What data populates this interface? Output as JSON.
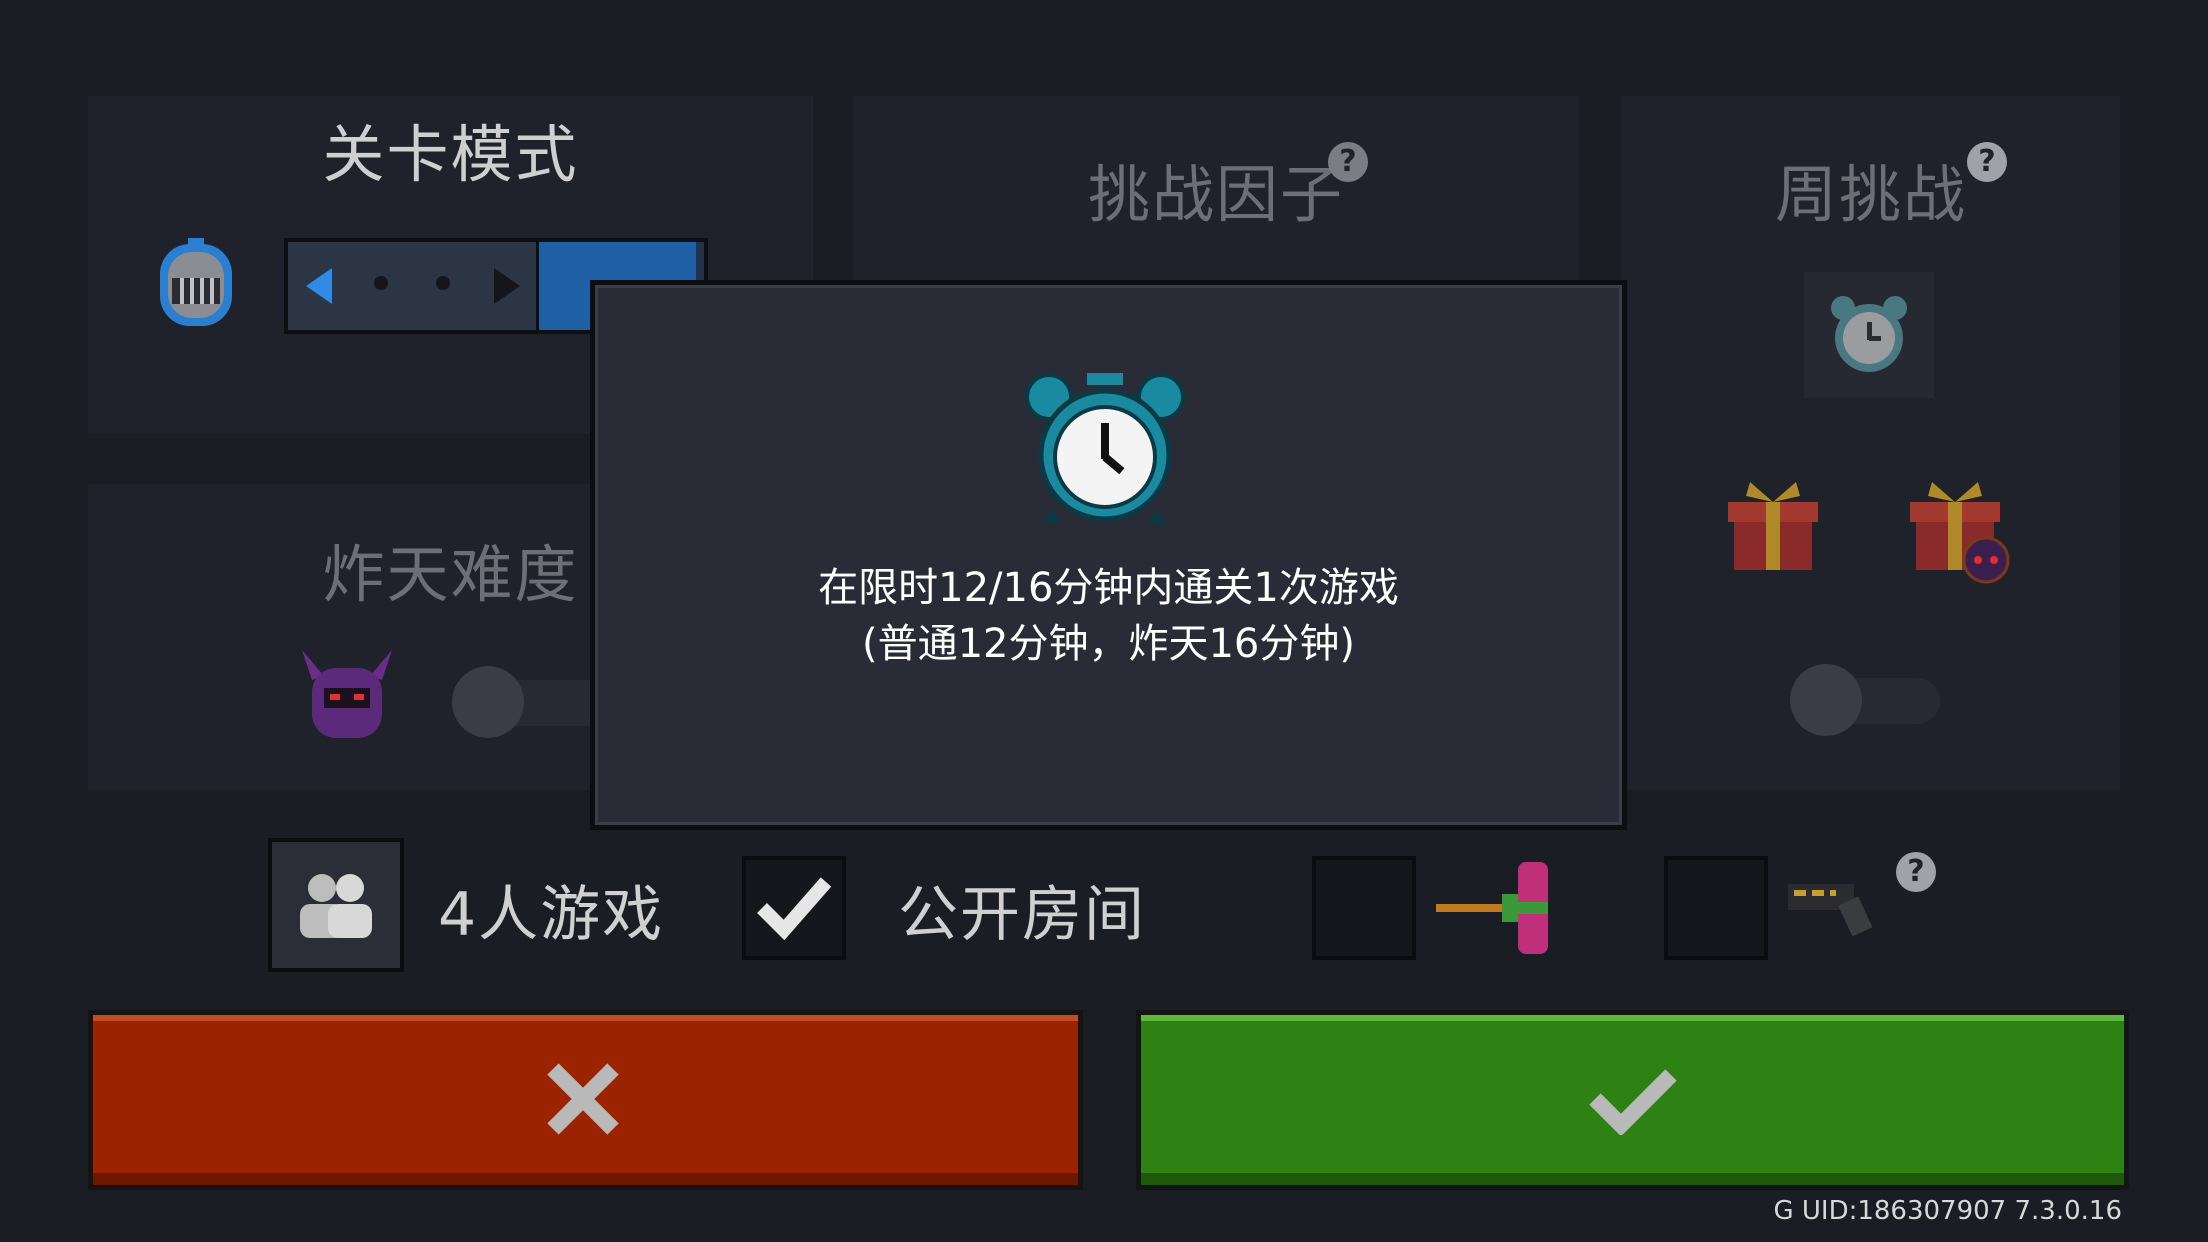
{
  "panels": {
    "level_mode": {
      "title": "关卡模式"
    },
    "challenge_factor": {
      "title": "挑战因子"
    },
    "weekly_challenge": {
      "title": "周挑战"
    },
    "hell_difficulty": {
      "title": "炸天难度"
    }
  },
  "modal": {
    "line1": "在限时12/16分钟内通关1次游戏",
    "line2": "(普通12分钟，炸天16分钟)",
    "icon": "alarm-clock-icon"
  },
  "options": {
    "players_label": "4人游戏",
    "public_room_label": "公开房间",
    "public_room_checked": true,
    "hammer_checked": false,
    "gun_checked": false
  },
  "buttons": {
    "cancel_icon": "✕",
    "confirm_icon": "✔"
  },
  "footer": {
    "uid": "G UID:186307907 7.3.0.16"
  },
  "colors": {
    "cancel": "#9c2300",
    "confirm": "#2e8213",
    "accent_blue": "#1f5fa3"
  }
}
